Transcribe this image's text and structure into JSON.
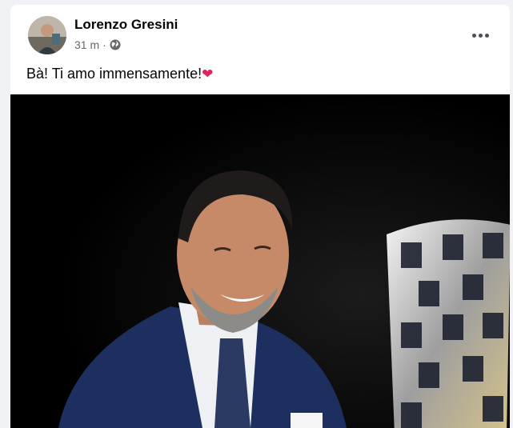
{
  "post": {
    "author": "Lorenzo Gresini",
    "time": "31 m",
    "separator": "·",
    "privacy_icon": "globe-icon",
    "text": "Bà! Ti amo immensamente!",
    "emoji": "❤",
    "more_icon": "more-dots-icon"
  },
  "colors": {
    "page_bg": "#f0f2f5",
    "card_bg": "#ffffff",
    "meta_text": "#65676b",
    "heart": "#e0245e"
  }
}
